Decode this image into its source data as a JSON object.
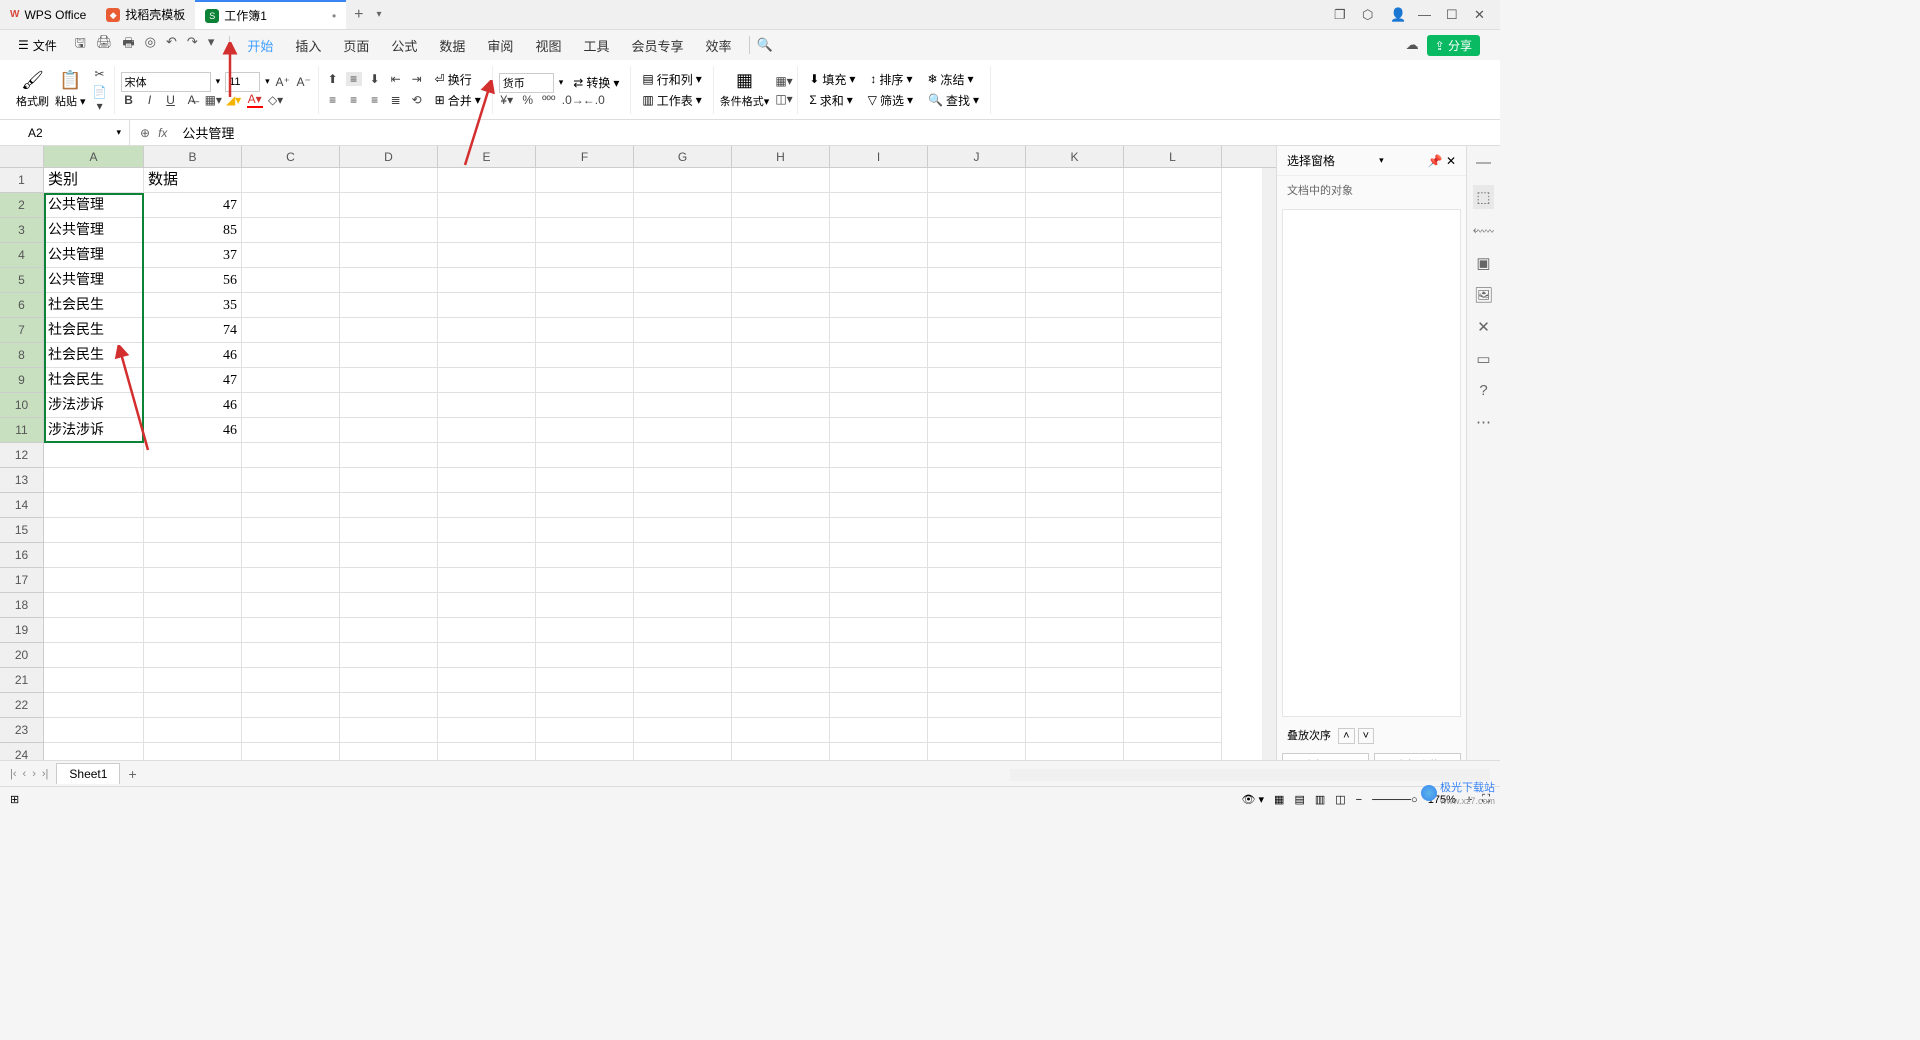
{
  "titlebar": {
    "tabs": [
      {
        "label": "WPS Office",
        "logo": "wps"
      },
      {
        "label": "找稻壳模板",
        "logo": "orange"
      },
      {
        "label": "工作簿1",
        "logo": "green",
        "active": true,
        "dirty": "•"
      }
    ]
  },
  "menubar": {
    "file": "文件",
    "items": [
      "开始",
      "插入",
      "页面",
      "公式",
      "数据",
      "审阅",
      "视图",
      "工具",
      "会员专享",
      "效率"
    ],
    "active": "开始",
    "share": "分享"
  },
  "ribbon": {
    "format_painter": "格式刷",
    "paste": "粘贴",
    "font_name": "宋体",
    "font_size": "11",
    "number_format": "货币",
    "wrap": "换行",
    "merge": "合并",
    "convert": "转换",
    "rowcol": "行和列",
    "worksheet": "工作表",
    "cond_format": "条件格式",
    "fill": "填充",
    "sort": "排序",
    "freeze": "冻结",
    "sum": "求和",
    "filter": "筛选",
    "find": "查找"
  },
  "namebox": "A2",
  "formula": "公共管理",
  "right_panel": {
    "title": "选择窗格",
    "subtitle": "文档中的对象",
    "stack": "叠放次序",
    "show_all": "全部显示",
    "hide_all": "全部隐藏"
  },
  "columns": [
    "A",
    "B",
    "C",
    "D",
    "E",
    "F",
    "G",
    "H",
    "I",
    "J",
    "K",
    "L"
  ],
  "rows": [
    {
      "n": 1,
      "A": "类别",
      "B": "数据",
      "header": true
    },
    {
      "n": 2,
      "A": "公共管理",
      "B": "47"
    },
    {
      "n": 3,
      "A": "公共管理",
      "B": "85"
    },
    {
      "n": 4,
      "A": "公共管理",
      "B": "37"
    },
    {
      "n": 5,
      "A": "公共管理",
      "B": "56"
    },
    {
      "n": 6,
      "A": "社会民生",
      "B": "35"
    },
    {
      "n": 7,
      "A": "社会民生",
      "B": "74"
    },
    {
      "n": 8,
      "A": "社会民生",
      "B": "46"
    },
    {
      "n": 9,
      "A": "社会民生",
      "B": "47"
    },
    {
      "n": 10,
      "A": "涉法涉诉",
      "B": "46"
    },
    {
      "n": 11,
      "A": "涉法涉诉",
      "B": "46"
    },
    {
      "n": 12,
      "A": "",
      "B": ""
    },
    {
      "n": 13,
      "A": "",
      "B": ""
    },
    {
      "n": 14,
      "A": "",
      "B": ""
    },
    {
      "n": 15,
      "A": "",
      "B": ""
    },
    {
      "n": 16,
      "A": "",
      "B": ""
    },
    {
      "n": 17,
      "A": "",
      "B": ""
    },
    {
      "n": 18,
      "A": "",
      "B": ""
    },
    {
      "n": 19,
      "A": "",
      "B": ""
    },
    {
      "n": 20,
      "A": "",
      "B": ""
    },
    {
      "n": 21,
      "A": "",
      "B": ""
    },
    {
      "n": 22,
      "A": "",
      "B": ""
    },
    {
      "n": 23,
      "A": "",
      "B": ""
    },
    {
      "n": 24,
      "A": "",
      "B": ""
    }
  ],
  "sheet": {
    "name": "Sheet1"
  },
  "status": {
    "zoom": "175%"
  },
  "watermark": "极光下载站"
}
